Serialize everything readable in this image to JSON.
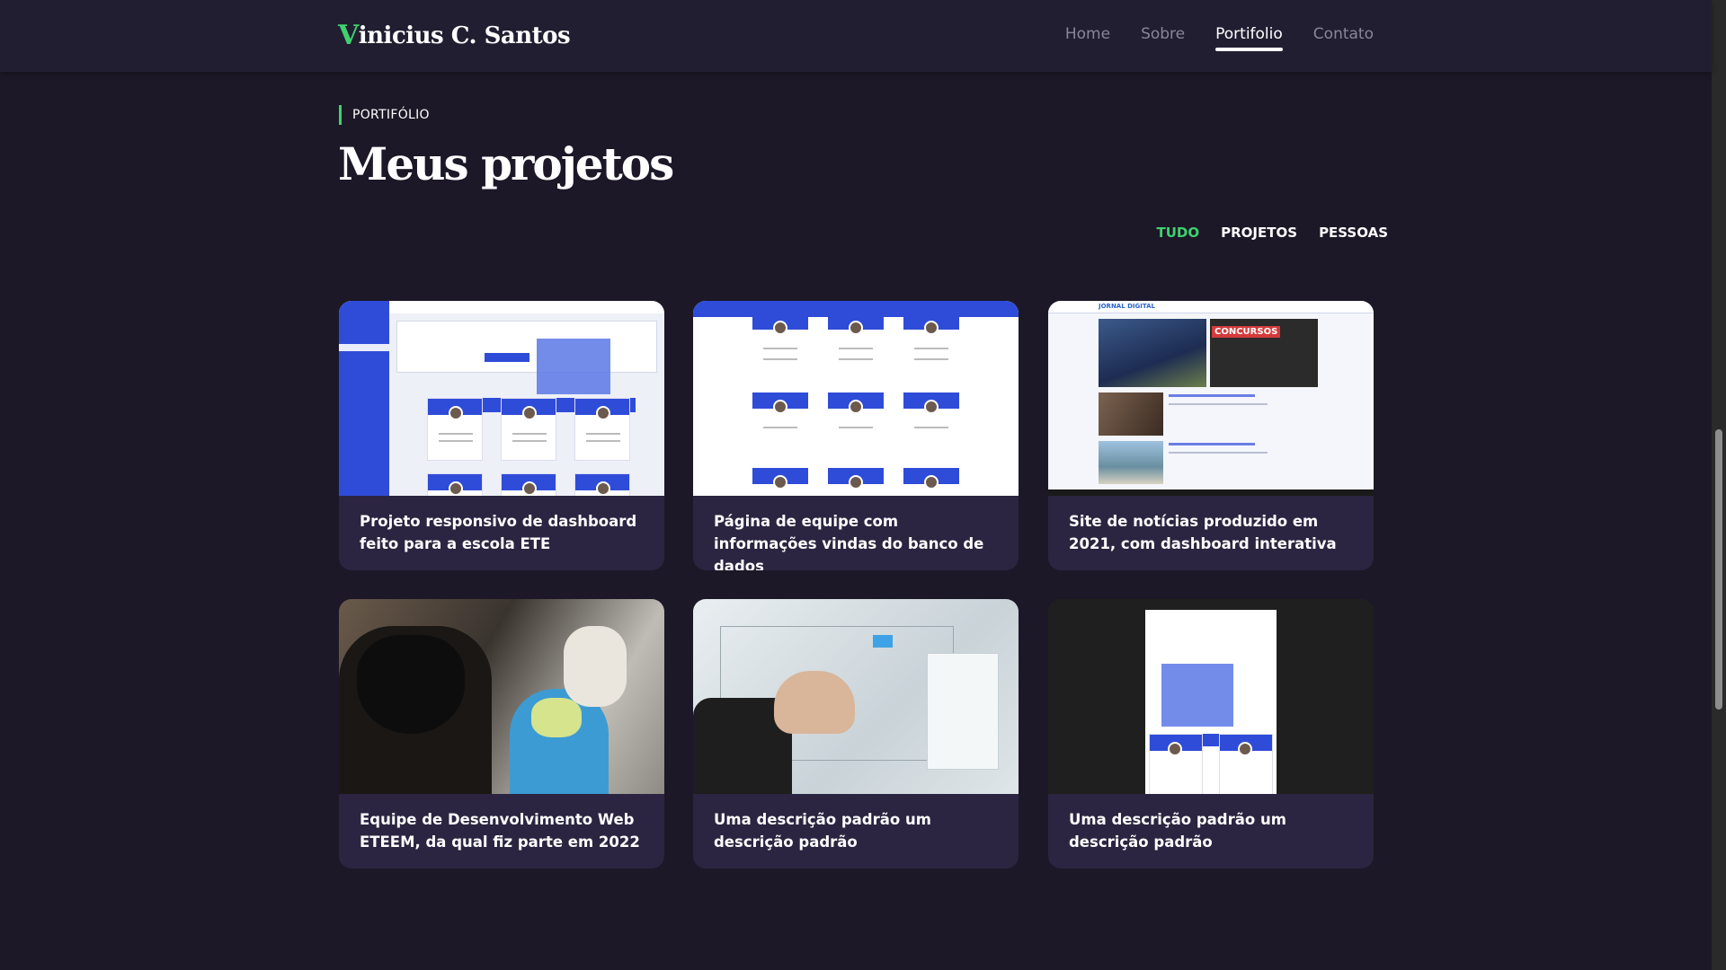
{
  "header": {
    "logo_mark": "V",
    "logo_text": "inicius C. Santos",
    "nav": [
      {
        "label": "Home"
      },
      {
        "label": "Sobre"
      },
      {
        "label": "Portifolio"
      },
      {
        "label": "Contato"
      }
    ],
    "active_nav": "Portifolio"
  },
  "section": {
    "eyebrow": "PORTIFÓLIO",
    "title": "Meus projetos"
  },
  "filters": [
    {
      "label": "TUDO"
    },
    {
      "label": "PROJETOS"
    },
    {
      "label": "PESSOAS"
    }
  ],
  "active_filter": "TUDO",
  "projects": [
    {
      "caption": "Projeto responsivo de dashboard feito para a escola ETE",
      "image": "dashboard-screenshot"
    },
    {
      "caption": "Página de equipe com informações vindas do banco de dados",
      "image": "team-page-screenshot"
    },
    {
      "caption": "Site de notícias produzido em 2021, com dashboard interativa",
      "image": "news-site-screenshot",
      "thumb_texts": {
        "site_name": "JORNAL DIGITAL",
        "banner": "CONCURSOS"
      }
    },
    {
      "caption": "Equipe de Desenvolvimento Web ETEEM, da qual fiz parte em 2022",
      "image": "team-photo"
    },
    {
      "caption": "Uma descrição padrão um descrição padrão",
      "image": "wireframe-board-photo"
    },
    {
      "caption": "Uma descrição padrão um descrição padrão",
      "image": "mobile-dashboard-screenshot"
    }
  ],
  "colors": {
    "background": "#1c1827",
    "header": "#221e32",
    "card": "#2b2541",
    "accent": "#3fd16e",
    "muted": "#8a8698"
  }
}
